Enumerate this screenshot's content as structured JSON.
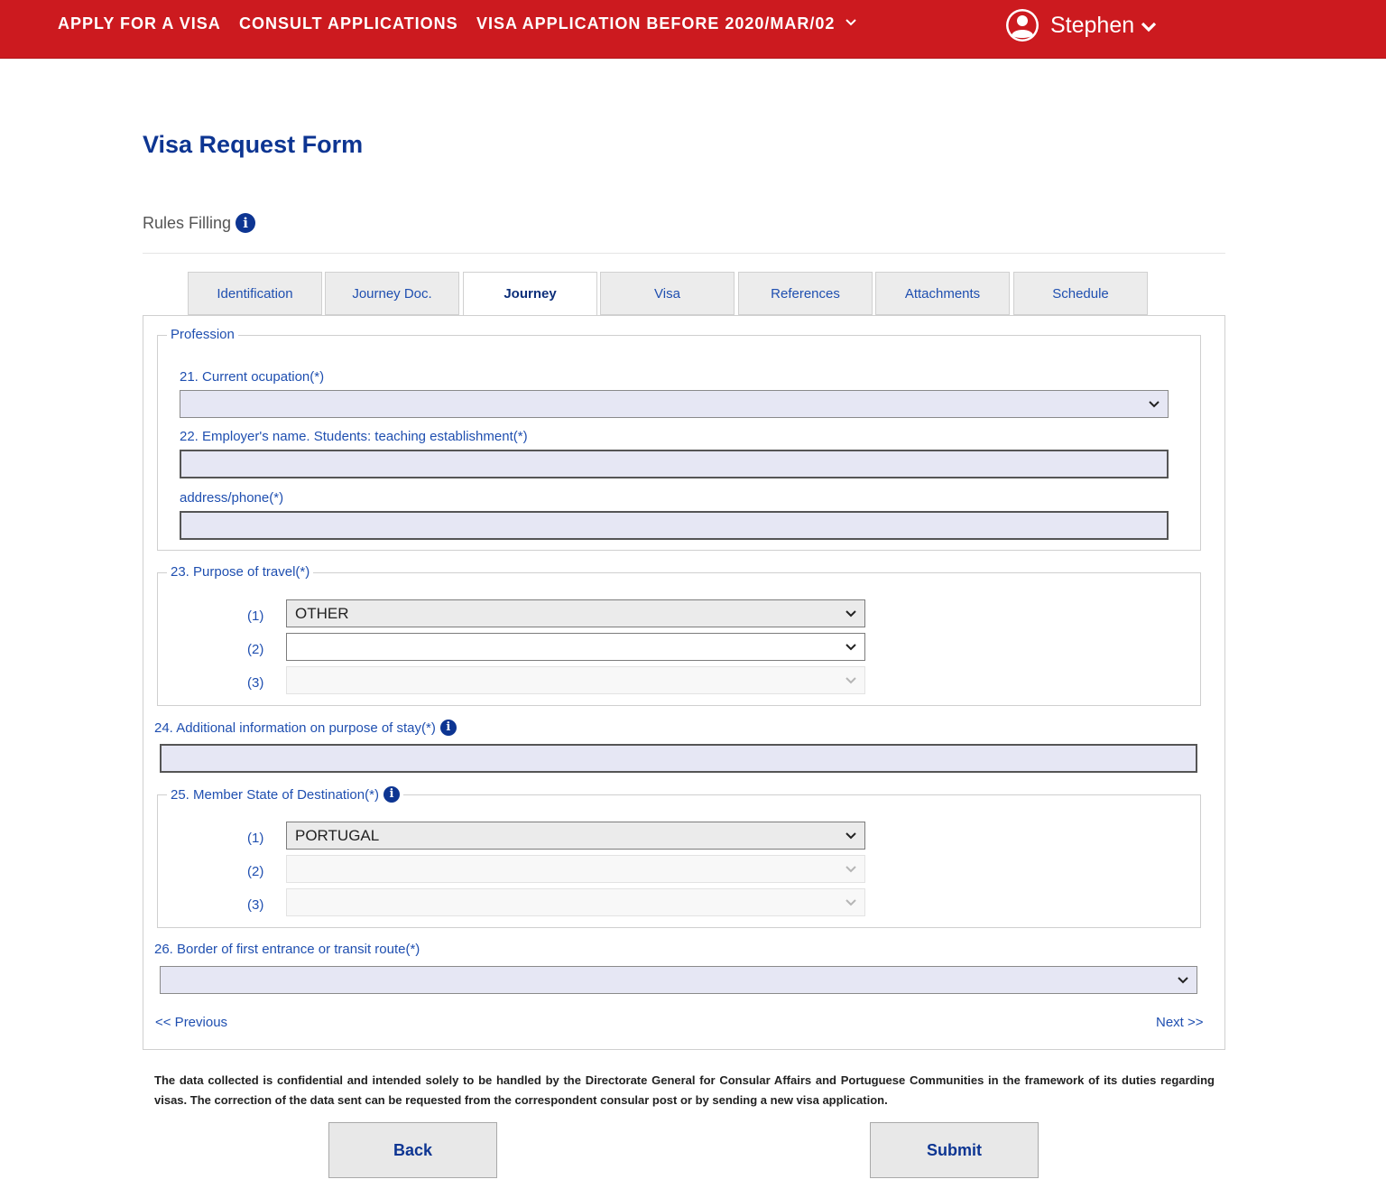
{
  "nav": {
    "apply": "APPLY FOR A VISA",
    "consult": "CONSULT APPLICATIONS",
    "before": "VISA APPLICATION BEFORE 2020/MAR/02",
    "user": "Stephen"
  },
  "page": {
    "title": "Visa Request Form",
    "rules": "Rules Filling"
  },
  "tabs": [
    "Identification",
    "Journey Doc.",
    "Journey",
    "Visa",
    "References",
    "Attachments",
    "Schedule"
  ],
  "active_tab": "Journey",
  "form": {
    "profession": {
      "legend": "Profession",
      "occupation_label": "21. Current ocupation(*)",
      "occupation_value": "",
      "employer_label": "22. Employer's name. Students: teaching establishment(*)",
      "employer_value": "",
      "address_label": "address/phone(*)",
      "address_value": ""
    },
    "purpose": {
      "legend": "23. Purpose of travel(*)",
      "rows": [
        {
          "num": "(1)",
          "value": "OTHER"
        },
        {
          "num": "(2)",
          "value": ""
        },
        {
          "num": "(3)",
          "value": ""
        }
      ]
    },
    "additional_info": {
      "label": "24. Additional information on purpose of stay(*)",
      "value": ""
    },
    "member_state": {
      "legend": "25. Member State of Destination(*)",
      "rows": [
        {
          "num": "(1)",
          "value": "PORTUGAL"
        },
        {
          "num": "(2)",
          "value": ""
        },
        {
          "num": "(3)",
          "value": ""
        }
      ]
    },
    "border": {
      "label": "26. Border of first entrance or transit route(*)",
      "value": ""
    },
    "previous": "<< Previous",
    "next": "Next >>"
  },
  "notice": "The data collected is confidential and intended solely to be handled by the Directorate General for Consular Affairs and Portuguese Communities in the framework of its duties regarding visas. The correction of the data sent can be requested from the correspondent consular post or by sending a new visa application.",
  "buttons": {
    "back": "Back",
    "submit": "Submit"
  },
  "colors": {
    "navbar": "#cc1a1f",
    "title": "#0d3592",
    "label": "#1f4fb0",
    "field": "#e6e7f4"
  }
}
